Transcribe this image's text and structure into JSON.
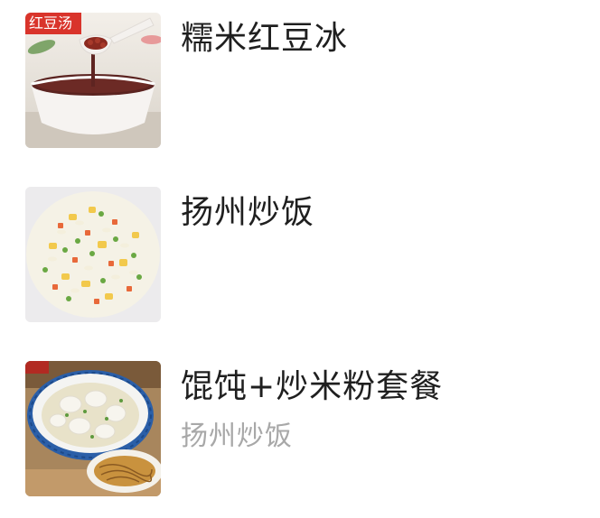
{
  "items": [
    {
      "title": "糯米红豆冰",
      "subtitle": "",
      "image_badge": "红豆汤",
      "image_icon": "red-bean-soup-image"
    },
    {
      "title": "扬州炒饭",
      "subtitle": "",
      "image_icon": "fried-rice-image"
    },
    {
      "title": "馄饨+炒米粉套餐",
      "subtitle": "扬州炒饭",
      "image_icon": "wonton-noodle-set-image"
    }
  ],
  "colors": {
    "title": "#1f1f1f",
    "subtitle": "#a8a8a8",
    "badge": "#d9342b"
  }
}
